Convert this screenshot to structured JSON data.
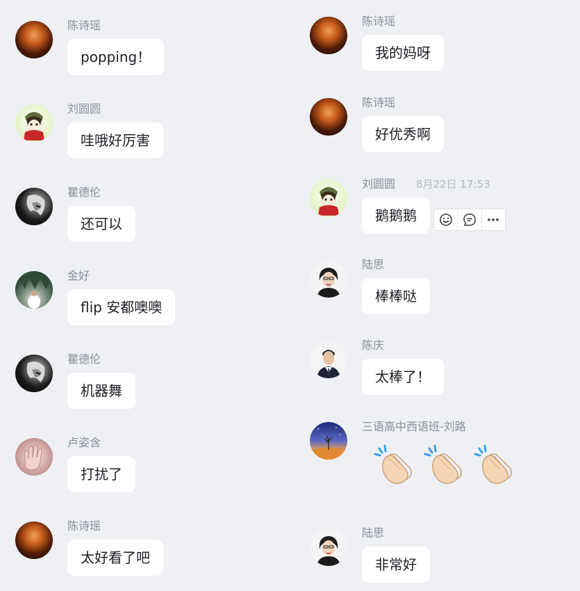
{
  "left_column": [
    {
      "sender": "陈诗瑶",
      "text": "popping！",
      "avatar": "fire-avatar"
    },
    {
      "sender": "刘圆圆",
      "text": "哇哦好厉害",
      "avatar": "anime-avatar"
    },
    {
      "sender": "瞿德伦",
      "text": "还可以",
      "avatar": "monochrome-avatar"
    },
    {
      "sender": "金好",
      "text": "flip 安都噢噢",
      "avatar": "forest-avatar"
    },
    {
      "sender": "瞿德伦",
      "text": "机器舞",
      "avatar": "monochrome-avatar"
    },
    {
      "sender": "卢姿含",
      "text": "打扰了",
      "avatar": "hand-avatar"
    },
    {
      "sender": "陈诗瑶",
      "text": "太好看了吧",
      "avatar": "fire-avatar"
    }
  ],
  "right_column": [
    {
      "sender": "陈诗瑶",
      "text": "我的妈呀",
      "avatar": "fire-avatar"
    },
    {
      "sender": "陈诗瑶",
      "text": "好优秀啊",
      "avatar": "fire-avatar"
    },
    {
      "sender": "刘圆圆",
      "timestamp": "8月22日 17:53",
      "text": "鹅鹅鹅",
      "avatar": "anime-avatar"
    },
    {
      "sender": "陆思",
      "text": "棒棒哒",
      "avatar": "portrait-avatar"
    },
    {
      "sender": "陈庆",
      "text": "太棒了！",
      "avatar": "portrait-avatar"
    },
    {
      "sender": "三语高中西语班-刘路",
      "emoji": "clapping-hands x3",
      "avatar": "night-sky-avatar"
    },
    {
      "sender": "陆思",
      "text": "非常好",
      "avatar": "portrait-avatar"
    }
  ],
  "message_actions": [
    "emoji-icon",
    "quote-icon",
    "more-icon"
  ],
  "colors": {
    "background": "#eef0f4",
    "bubble": "#ffffff",
    "sender_name": "#8a8f99",
    "timestamp": "#b4b9c2",
    "message_text": "#1c1f24"
  }
}
